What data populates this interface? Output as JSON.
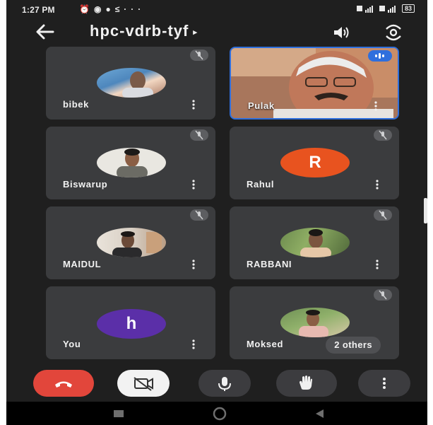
{
  "status_bar": {
    "time": "1:27 PM",
    "left_icons": [
      "alarm-icon",
      "messenger-icon",
      "chat-icon",
      "mute-notification-icon",
      "more-dots-icon"
    ],
    "battery": "83"
  },
  "app_bar": {
    "meeting_code": "hpc-vdrb-tyf",
    "caret": "▸"
  },
  "tiles": [
    {
      "name": "bibek",
      "type": "photo",
      "muted": true
    },
    {
      "name": "Pulak",
      "type": "video",
      "muted": false,
      "speaking": true
    },
    {
      "name": "Biswarup",
      "type": "photo",
      "muted": true
    },
    {
      "name": "Rahul",
      "type": "letter",
      "letter": "R",
      "avatar_color": "#e8531f",
      "muted": true
    },
    {
      "name": "MAIDUL",
      "type": "photo",
      "muted": true
    },
    {
      "name": "RABBANI",
      "type": "photo",
      "muted": true
    },
    {
      "name": "You",
      "type": "letter",
      "letter": "h",
      "avatar_color": "#5b2fa8",
      "muted": false
    },
    {
      "name": "Moksed",
      "type": "photo",
      "muted": true,
      "others_label": "2 others"
    }
  ],
  "controls": [
    "end-call",
    "camera-off",
    "microphone",
    "raise-hand",
    "more-options"
  ],
  "colors": {
    "end_call": "#e2463b",
    "camera_off_bg": "#f2f2f2",
    "control_bg": "#3c3c3f",
    "active_border": "#2f6fdd"
  }
}
